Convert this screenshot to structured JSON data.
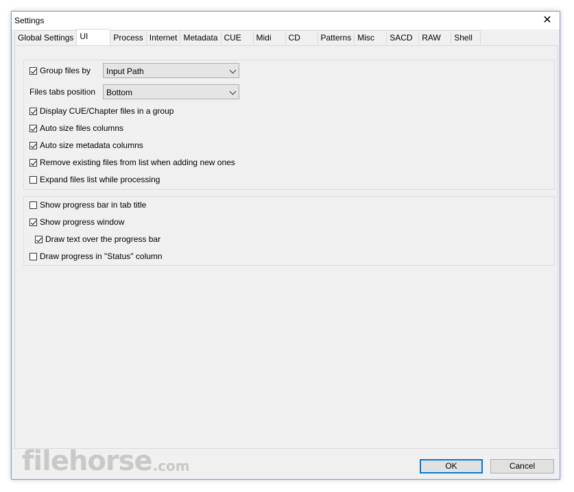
{
  "window": {
    "title": "Settings",
    "close_glyph": "✕"
  },
  "tabs": [
    {
      "label": "Global Settings",
      "active": false
    },
    {
      "label": "UI",
      "active": true
    },
    {
      "label": "Process",
      "active": false
    },
    {
      "label": "Internet",
      "active": false
    },
    {
      "label": "Metadata",
      "active": false
    },
    {
      "label": "CUE",
      "active": false
    },
    {
      "label": "Midi",
      "active": false
    },
    {
      "label": "CD",
      "active": false
    },
    {
      "label": "Patterns",
      "active": false
    },
    {
      "label": "Misc",
      "active": false
    },
    {
      "label": "SACD",
      "active": false
    },
    {
      "label": "RAW",
      "active": false
    },
    {
      "label": "Shell",
      "active": false
    }
  ],
  "group1": {
    "group_files_by": {
      "label": "Group files by",
      "checked": true,
      "value": "Input Path"
    },
    "files_tabs_position": {
      "label": "Files tabs position",
      "value": "Bottom"
    },
    "display_cue": {
      "label": "Display CUE/Chapter files in a group",
      "checked": true
    },
    "auto_size_files": {
      "label": "Auto size files columns",
      "checked": true
    },
    "auto_size_metadata": {
      "label": "Auto size metadata columns",
      "checked": true
    },
    "remove_existing": {
      "label": "Remove existing files from list when adding new ones",
      "checked": true
    },
    "expand_files": {
      "label": "Expand files list while processing",
      "checked": false
    }
  },
  "group2": {
    "progress_tab_title": {
      "label": "Show progress bar in tab title",
      "checked": false
    },
    "progress_window": {
      "label": "Show progress window",
      "checked": true
    },
    "draw_text": {
      "label": "Draw text over the progress bar",
      "checked": true
    },
    "draw_status": {
      "label": "Draw progress in \"Status\" column",
      "checked": false
    }
  },
  "buttons": {
    "ok": "OK",
    "cancel": "Cancel"
  },
  "watermark": {
    "main": "filehorse",
    "suffix": ".com"
  },
  "colors": {
    "accent": "#0078d7",
    "window_bg": "#f0f0f0"
  }
}
